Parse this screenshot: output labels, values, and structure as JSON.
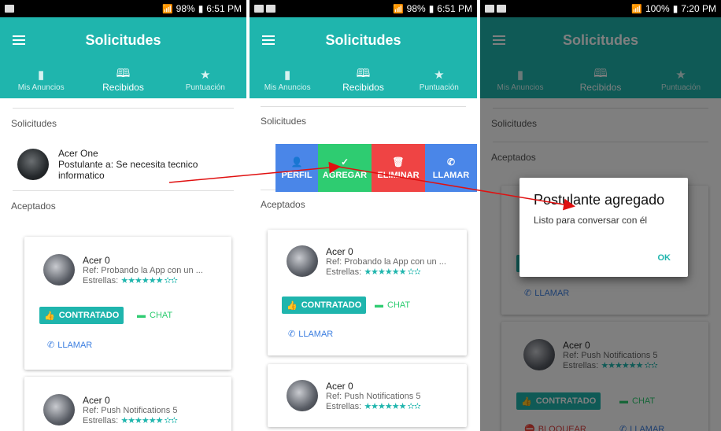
{
  "screens": [
    {
      "status": {
        "battery": "98%",
        "time": "6:51 PM"
      },
      "title": "Solicitudes",
      "tabs": [
        {
          "label": "Mis Anuncios",
          "icon": "card-icon"
        },
        {
          "label": "Recibidos",
          "icon": "book-icon"
        },
        {
          "label": "Puntuación",
          "icon": "star-icon"
        }
      ],
      "section_solicitudes": "Solicitudes",
      "request": {
        "name": "Acer One",
        "line1": "Postulante a: Se necesita tecnico",
        "line2": "informatico"
      },
      "section_aceptados": "Aceptados",
      "cards": [
        {
          "name": "Acer 0",
          "ref": "Ref: Probando la App con un ...",
          "stars_label": "Estrellas:",
          "stars": "★★★★★★ ✫✫",
          "contratado": "CONTRATADO",
          "chat": "CHAT",
          "llamar": "LLAMAR"
        },
        {
          "name": "Acer 0",
          "ref": "Ref: Push Notifications 5",
          "stars_label": "Estrellas:",
          "stars": "★★★★★★ ✫✫"
        }
      ]
    },
    {
      "status": {
        "battery": "98%",
        "time": "6:51 PM"
      },
      "title": "Solicitudes",
      "tabs": [
        {
          "label": "Mis Anuncios"
        },
        {
          "label": "Recibidos"
        },
        {
          "label": "Puntuación"
        }
      ],
      "section_solicitudes": "Solicitudes",
      "swipe_actions": [
        "PERFIL",
        "AGREGAR",
        "ELIMINAR",
        "LLAMAR"
      ],
      "section_aceptados": "Aceptados",
      "cards": [
        {
          "name": "Acer 0",
          "ref": "Ref: Probando la App con un ...",
          "stars_label": "Estrellas:",
          "stars": "★★★★★★ ✫✫",
          "contratado": "CONTRATADO",
          "chat": "CHAT",
          "llamar": "LLAMAR"
        },
        {
          "name": "Acer 0",
          "ref": "Ref: Push Notifications 5",
          "stars_label": "Estrellas:",
          "stars": "★★★★★★ ✫✫"
        }
      ]
    },
    {
      "status": {
        "battery": "100%",
        "time": "7:20 PM"
      },
      "title": "Solicitudes",
      "tabs": [
        {
          "label": "Mis Anuncios"
        },
        {
          "label": "Recibidos"
        },
        {
          "label": "Puntuación"
        }
      ],
      "section_solicitudes": "Solicitudes",
      "section_aceptados": "Aceptados",
      "card_partial": {
        "llamar": "LLAMAR"
      },
      "card2": {
        "name": "Acer 0",
        "ref": "Ref: Push Notifications 5",
        "stars_label": "Estrellas:",
        "stars": "★★★★★★ ✫✫",
        "contratado": "CONTRATADO",
        "chat": "CHAT",
        "bloquear": "BLOQUEAR",
        "llamar": "LLAMAR"
      },
      "dialog": {
        "title": "Postulante agregado",
        "message": "Listo para conversar con él",
        "ok": "OK"
      }
    }
  ],
  "colors": {
    "teal": "#1fb5ad",
    "swipe_perfil": "#4a86e8",
    "swipe_agregar": "#2ecc71",
    "swipe_eliminar": "#ef4444",
    "swipe_llamar": "#4a86e8",
    "arrow": "#e01010"
  }
}
